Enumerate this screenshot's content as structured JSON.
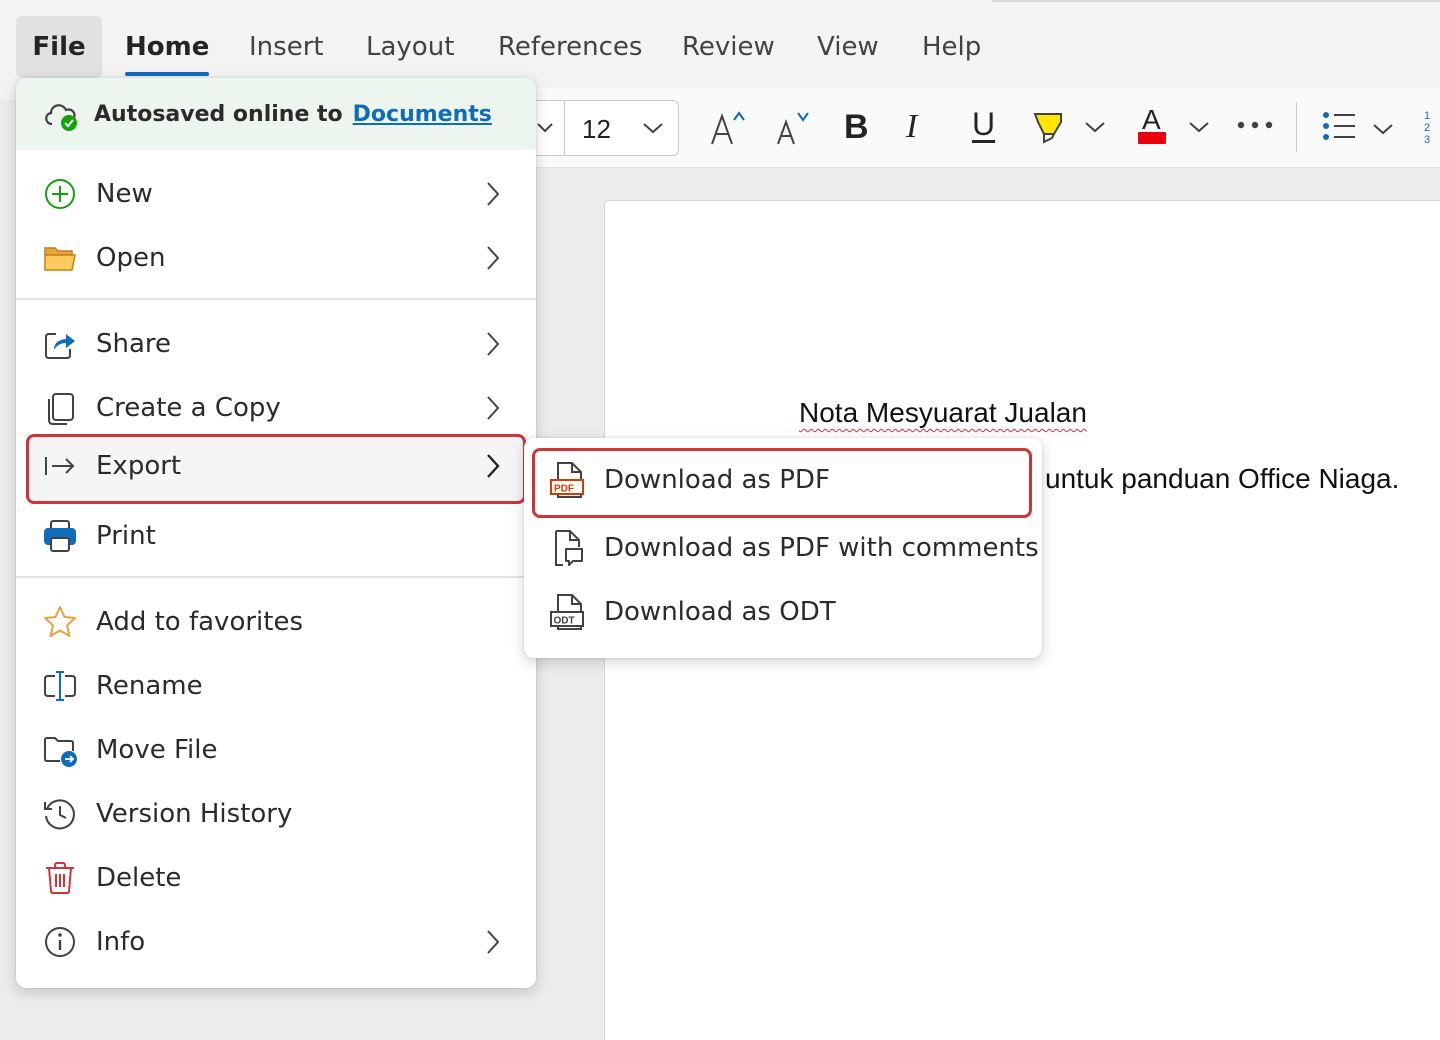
{
  "tabs": {
    "file": "File",
    "home": "Home",
    "insert": "Insert",
    "layout": "Layout",
    "references": "References",
    "review": "Review",
    "view": "View",
    "help": "Help"
  },
  "ribbon": {
    "font_size": "12",
    "icons": [
      "grow-font-icon",
      "shrink-font-icon",
      "bold-icon",
      "italic-icon",
      "underline-icon",
      "highlight-icon",
      "font-color-icon",
      "more-options-icon",
      "bullets-icon",
      "numbering-icon"
    ],
    "bold_glyph": "B",
    "italic_glyph": "I",
    "underline_glyph": "U",
    "font_color_glyph": "A",
    "font_color": "#e8000b",
    "highlight_color": "#ffe500"
  },
  "file_menu": {
    "autosave_text": "Autosaved online to",
    "autosave_link": "Documents",
    "items": [
      {
        "label": "New",
        "icon": "plus-circle-icon",
        "has_submenu": true
      },
      {
        "label": "Open",
        "icon": "folder-icon",
        "has_submenu": true
      },
      {
        "label": "Share",
        "icon": "share-icon",
        "has_submenu": true
      },
      {
        "label": "Create a Copy",
        "icon": "copy-icon",
        "has_submenu": true
      },
      {
        "label": "Export",
        "icon": "export-icon",
        "has_submenu": true
      },
      {
        "label": "Print",
        "icon": "printer-icon",
        "has_submenu": false
      },
      {
        "label": "Add to favorites",
        "icon": "star-icon",
        "has_submenu": false
      },
      {
        "label": "Rename",
        "icon": "rename-icon",
        "has_submenu": false
      },
      {
        "label": "Move File",
        "icon": "move-file-icon",
        "has_submenu": false
      },
      {
        "label": "Version History",
        "icon": "history-icon",
        "has_submenu": false
      },
      {
        "label": "Delete",
        "icon": "trash-icon",
        "has_submenu": false
      },
      {
        "label": "Info",
        "icon": "info-icon",
        "has_submenu": true
      }
    ]
  },
  "export_submenu": {
    "items": [
      {
        "label": "Download as PDF",
        "icon": "pdf-file-icon"
      },
      {
        "label": "Download as PDF with comments",
        "icon": "pdf-comments-icon"
      },
      {
        "label": "Download as ODT",
        "icon": "odt-file-icon"
      }
    ]
  },
  "document": {
    "title": "Nota Mesyuarat Jualan",
    "line2": "untuk panduan Office Niaga."
  },
  "colors": {
    "accent": "#0f6cbd",
    "highlight_border": "#d13438",
    "autosave_bg": "#edf5ef",
    "check_green": "#13a10e",
    "pdf_red": "#d83b01",
    "star_orange": "#e8a33d"
  }
}
